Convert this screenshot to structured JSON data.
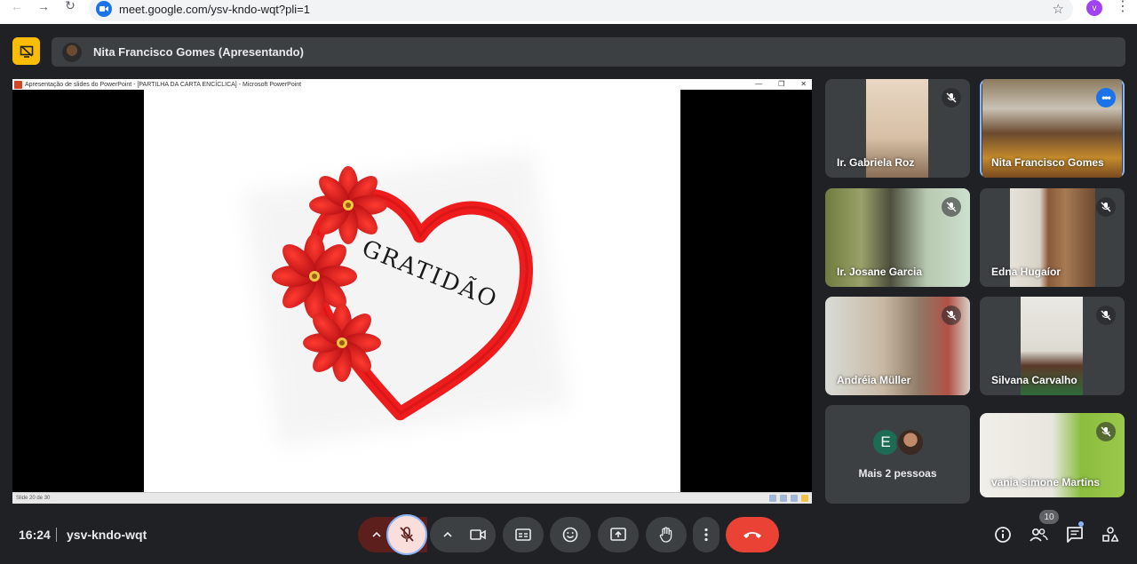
{
  "browser": {
    "url": "meet.google.com/ysv-kndo-wqt?pli=1",
    "profile_initial": "v"
  },
  "presenter": {
    "label": "Nita Francisco Gomes (Apresentando)"
  },
  "shared_screen": {
    "window_title": "Apresentação de slides do PowerPoint - [PARTILHA DA CARTA ENCÍCLICA] - Microsoft PowerPoint",
    "slide_text": "GRATIDÃO",
    "status_text": "Slide 20 de 30",
    "colors": {
      "heart": "#ee1c1c",
      "flower": "#d9141a"
    }
  },
  "participants": [
    {
      "name": "Ir. Gabriela Roz",
      "muted": true
    },
    {
      "name": "Nita Francisco Gomes",
      "muted": false,
      "active": true
    },
    {
      "name": "Ir. Josane Garcia",
      "muted": true
    },
    {
      "name": "Edna Hugaíor",
      "muted": true
    },
    {
      "name": "Andréia Müller",
      "muted": true
    },
    {
      "name": "Silvana Carvalho",
      "muted": true
    },
    {
      "name": "vania simone Martins",
      "muted": true
    }
  ],
  "more_people": {
    "avatar_initial": "E",
    "label": "Mais 2 pessoas"
  },
  "bottom": {
    "time": "16:24",
    "meeting_code": "ysv-kndo-wqt",
    "people_count": "10"
  },
  "colors": {
    "end_call": "#ea4335",
    "mic_muted_bg": "#f9dedc",
    "present_badge": "#fbbc04",
    "accent": "#8ab4f8"
  }
}
